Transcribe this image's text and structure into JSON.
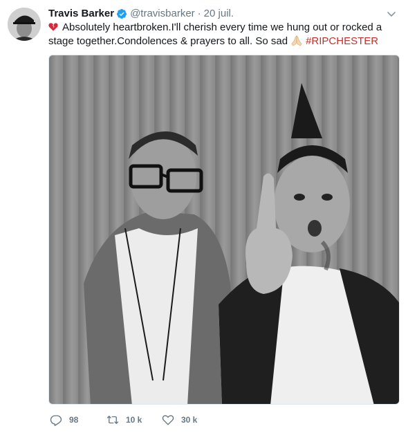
{
  "tweet": {
    "author_name": "Travis Barker",
    "author_handle": "@travisbarker",
    "separator": "·",
    "date": "20 juil.",
    "text_part1": "Absolutely heartbroken.I'll cherish every time we hung out or rocked a stage together.Condolences & prayers to all. So sad",
    "hashtag": "#RIPCHESTER",
    "media_icon": "photo",
    "avatar_icon": "profile-photo"
  },
  "actions": {
    "replies": "98",
    "retweets": "10 k",
    "likes": "30 k"
  },
  "colors": {
    "text": "#14171a",
    "muted": "#657786",
    "verified": "#1da1f2",
    "hashtag": "#c4302b"
  }
}
